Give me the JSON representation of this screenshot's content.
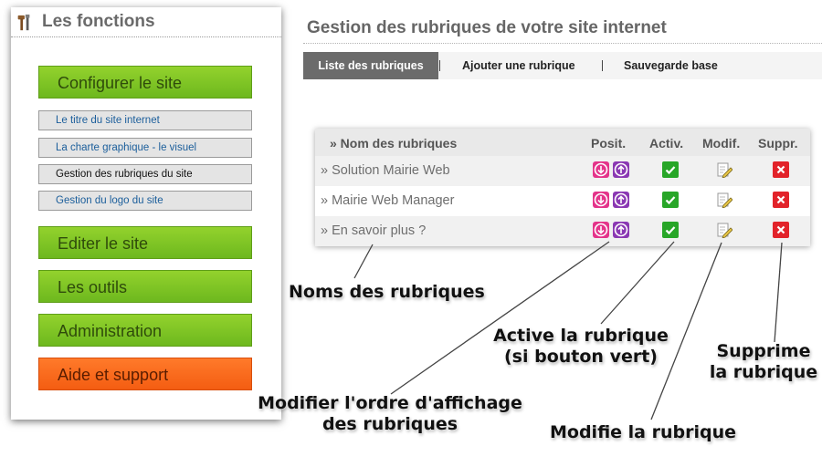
{
  "sidebar": {
    "title": "Les fonctions",
    "menu": {
      "configure": "Configurer le site",
      "sub": [
        "Le titre du site internet",
        "La charte graphique - le visuel",
        "Gestion des rubriques du site",
        "Gestion du logo du site"
      ],
      "edit": "Editer le site",
      "tools": "Les outils",
      "admin": "Administration",
      "help": "Aide et support"
    }
  },
  "main": {
    "title": "Gestion des rubriques de votre site internet",
    "tabs": [
      "Liste des rubriques",
      "Ajouter une rubrique",
      "Sauvegarde base"
    ],
    "table": {
      "headers": [
        "» Nom des rubriques",
        "Posit.",
        "Activ.",
        "Modif.",
        "Suppr."
      ],
      "rows": [
        "» Solution Mairie Web",
        "» Mairie Web Manager",
        "» En savoir plus ?"
      ]
    }
  },
  "annotations": {
    "noms": "Noms des rubriques",
    "active_1": "Active la rubrique",
    "active_2": "(si bouton vert)",
    "supprime_1": "Supprime",
    "supprime_2": "la rubrique",
    "ordre_1": "Modifier l'ordre d'affichage",
    "ordre_2": "des rubriques",
    "modifie": "Modifie la rubrique"
  },
  "icons": {
    "sidebar_header": "tools-icon",
    "position_down": "arrow-down-circle-icon",
    "position_up": "arrow-up-circle-icon",
    "active": "check-icon",
    "edit": "edit-pencil-icon",
    "delete": "delete-x-icon"
  },
  "colors": {
    "menu_green": "#7dc424",
    "menu_orange": "#f56a1c",
    "tab_active": "#6b6b6b",
    "check_green": "#28a628",
    "delete_red": "#e2232a",
    "pos_down": "#e4338a",
    "pos_up": "#8a38b3"
  }
}
